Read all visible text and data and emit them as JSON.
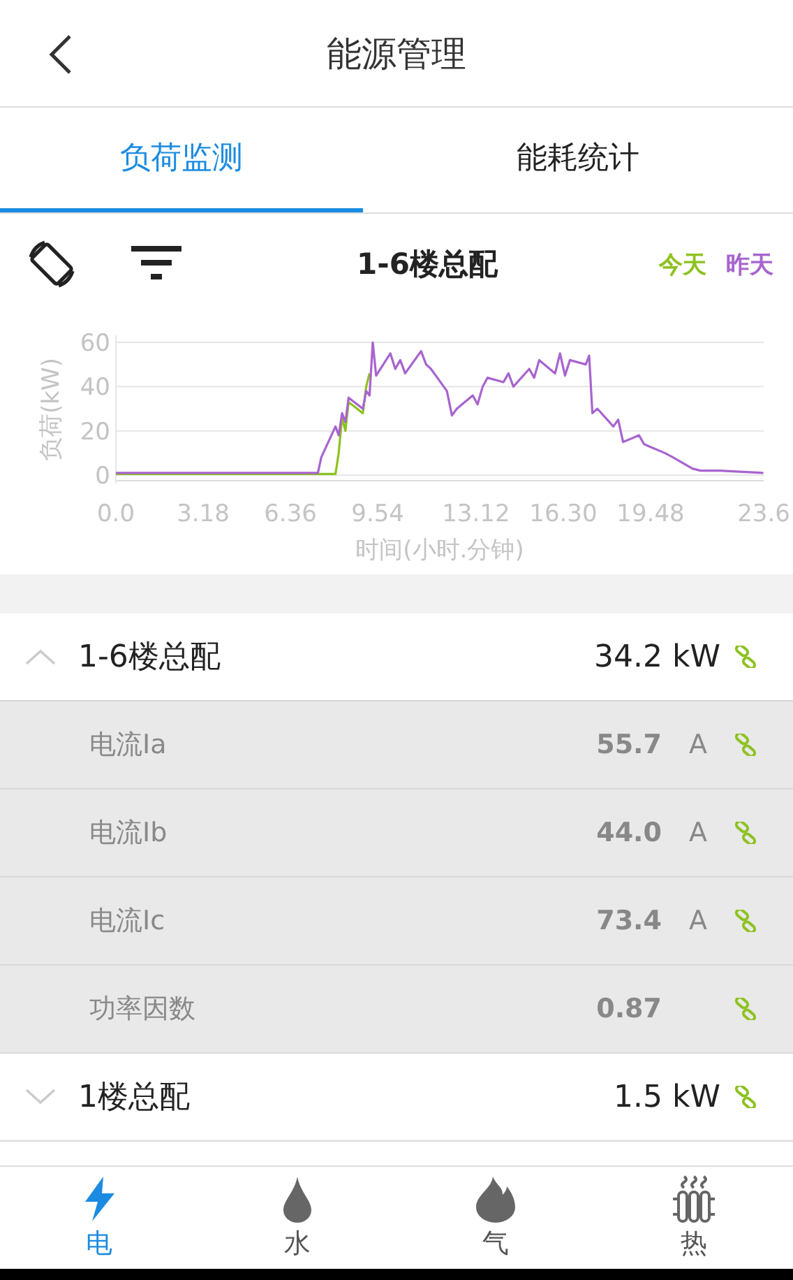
{
  "header": {
    "title": "能源管理"
  },
  "tabs": [
    {
      "label": "负荷监测",
      "selected": true
    },
    {
      "label": "能耗统计",
      "selected": false
    }
  ],
  "toolbar": {
    "title": "1-6楼总配"
  },
  "chart_data": {
    "type": "line",
    "xlabel": "时间(小时.分钟)",
    "ylabel": "负荷(kW)",
    "xlim": [
      0,
      23.6
    ],
    "ylim": [
      0,
      60
    ],
    "xticks": [
      {
        "value": 0,
        "label": "0.0"
      },
      3.18,
      6.36,
      9.54,
      13.12,
      {
        "value": 16.3,
        "label": "16.30"
      },
      19.48,
      23.6
    ],
    "yticks": [
      0,
      20,
      40,
      {
        "value": 60,
        "label": "60"
      }
    ],
    "x": [
      0,
      7.36,
      7.48,
      8.0,
      8.12,
      8.24,
      8.36,
      8.48,
      9.0,
      9.12,
      9.24,
      9.36,
      9.48,
      10.0,
      10.18,
      10.36,
      10.54,
      11.12,
      11.3,
      11.48,
      12.06,
      12.24,
      12.42,
      13.0,
      13.18,
      13.36,
      13.54,
      14.12,
      14.3,
      14.48,
      15.06,
      15.24,
      15.42,
      16.0,
      16.18,
      16.36,
      16.54,
      17.12,
      17.24,
      17.36,
      17.54,
      18.12,
      18.3,
      18.48,
      19.06,
      19.24,
      19.42,
      20.0,
      20.3,
      21.0,
      21.3,
      22.0,
      23.59
    ],
    "series": [
      {
        "name": "今天",
        "color": "#8dc21f",
        "values": [
          0.5,
          0.5,
          0.5,
          0.5,
          10,
          26,
          20,
          33,
          28,
          40,
          46,
          null,
          null,
          null,
          null,
          null,
          null,
          null,
          null,
          null,
          null,
          null,
          null,
          null,
          null,
          null,
          null,
          null,
          null,
          null,
          null,
          null,
          null,
          null,
          null,
          null,
          null,
          null,
          null,
          null,
          null,
          null,
          null,
          null,
          null,
          null,
          null,
          null,
          null,
          null,
          null,
          null,
          null
        ]
      },
      {
        "name": "昨天",
        "color": "#a864cf",
        "values": [
          1,
          1,
          8,
          22,
          18,
          28,
          24,
          35,
          30,
          38,
          36,
          60,
          45,
          55,
          48,
          52,
          46,
          56,
          50,
          48,
          38,
          27,
          30,
          36,
          32,
          40,
          44,
          42,
          46,
          40,
          48,
          44,
          52,
          46,
          55,
          45,
          52,
          50,
          54,
          28,
          30,
          22,
          25,
          15,
          18,
          14,
          13,
          10,
          8,
          3,
          2,
          2,
          1
        ]
      }
    ]
  },
  "groups": [
    {
      "name": "1-6楼总配",
      "value": "34.2 kW",
      "expanded": true,
      "items": [
        {
          "label": "电流Ia",
          "value": "55.7",
          "unit": "A"
        },
        {
          "label": "电流Ib",
          "value": "44.0",
          "unit": "A"
        },
        {
          "label": "电流Ic",
          "value": "73.4",
          "unit": "A"
        },
        {
          "label": "功率因数",
          "value": "0.87"
        }
      ]
    },
    {
      "name": "1楼总配",
      "value": "1.5 kW",
      "expanded": false
    }
  ],
  "bottom_nav": [
    {
      "label": "电",
      "kind": "bolt",
      "selected": true
    },
    {
      "label": "水",
      "kind": "drop",
      "selected": false
    },
    {
      "label": "气",
      "kind": "flame",
      "selected": false
    },
    {
      "label": "热",
      "kind": "radiator",
      "selected": false
    }
  ]
}
